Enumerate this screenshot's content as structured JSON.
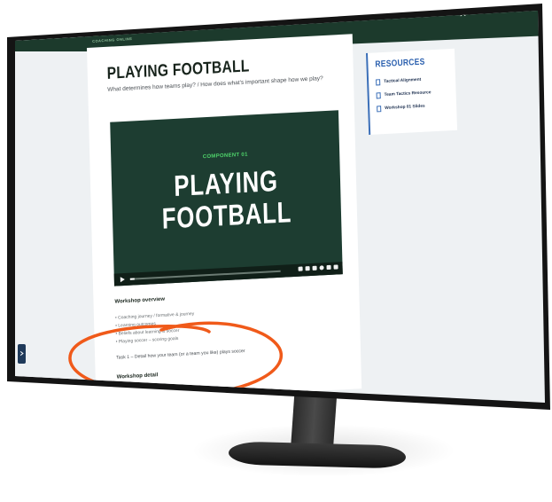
{
  "header": {
    "logo_text": "ELITE",
    "logo_subtext": "COACHING ONLINE",
    "nav": [
      {
        "label": "LEARNING HUB HOME"
      },
      {
        "label": "DISCUSSION FORUM"
      },
      {
        "label": "SESSION LIBRARY"
      }
    ],
    "user_icon": "user-icon"
  },
  "page": {
    "title": "PLAYING FOOTBALL",
    "subtitle": "What determines how teams play? / How does what's important shape how we play?"
  },
  "video": {
    "eyebrow": "COMPONENT 01",
    "title_line1": "PLAYING",
    "title_line2": "FOOTBALL",
    "progress_fraction": 0.03
  },
  "overview": {
    "heading": "Workshop overview",
    "items": [
      "Coaching journey / formative & journey",
      "Learning outcomes",
      "Beliefs about learning & soccer",
      "Playing soccer – scoring goals"
    ],
    "task": "Task 1 – Detail how your team (or a team you like) plays soccer",
    "detail_heading": "Workshop detail"
  },
  "resources": {
    "title": "RESOURCES",
    "items": [
      {
        "label": "Tactical Alignment",
        "icon": "document-icon"
      },
      {
        "label": "Team Tactics Resource",
        "icon": "document-icon"
      },
      {
        "label": "Workshop 01 Slides",
        "icon": "document-icon"
      }
    ]
  },
  "colors": {
    "header_bg": "#1c3a2c",
    "logo_green": "#5fd35a",
    "video_bg": "#1d3d31",
    "accent_blue": "#2a5fae",
    "annotation_orange": "#f05a1a"
  }
}
